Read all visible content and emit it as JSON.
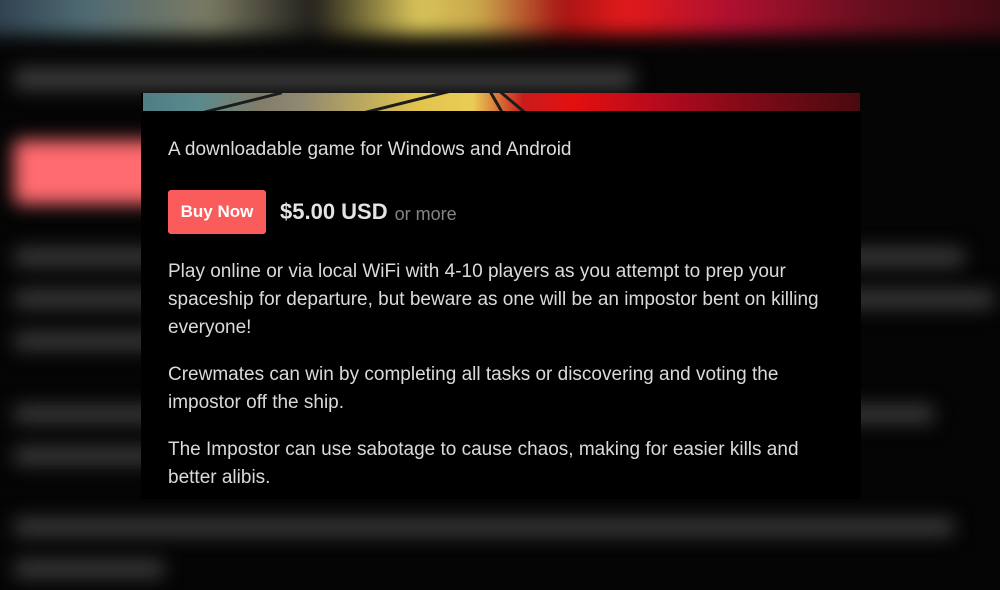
{
  "game_page": {
    "subtitle": "A downloadable game for Windows and Android",
    "buy_button_label": "Buy Now",
    "price": "$5.00 USD",
    "price_suffix": "or more",
    "description": [
      "Play online or via local WiFi with 4-10 players as you attempt to prep your spaceship for departure, but beware as one will be an impostor bent on killing everyone!",
      "Crewmates can win by completing all tasks or discovering and voting the impostor off the ship.",
      "The Impostor can use sabotage to cause chaos, making for easier kills and better alibis."
    ]
  },
  "colors": {
    "accent": "#fa5c5c",
    "background": "#000000",
    "text": "#dadada",
    "muted": "#858585"
  }
}
